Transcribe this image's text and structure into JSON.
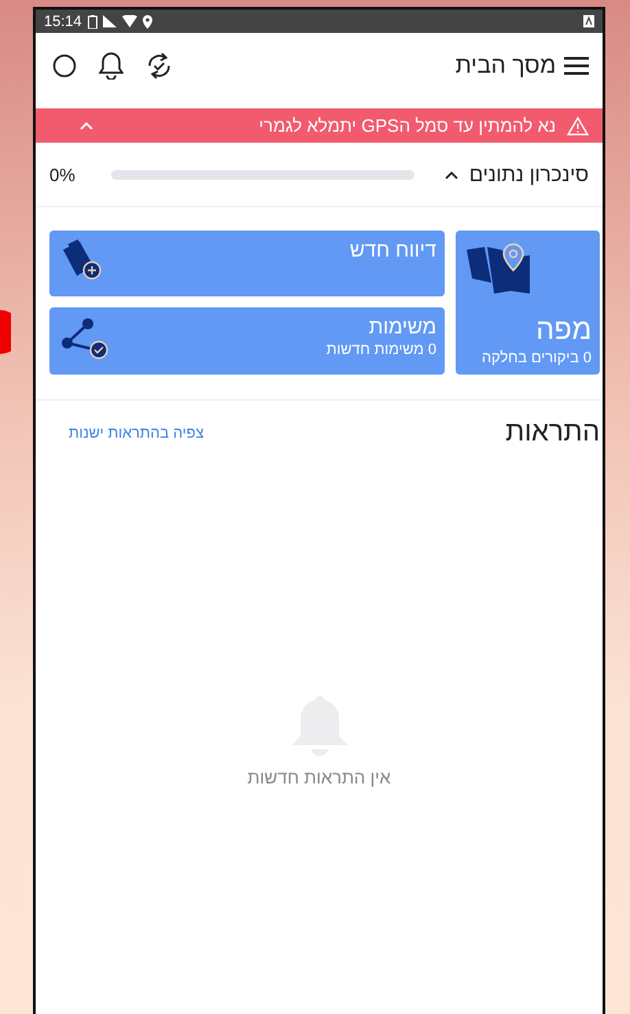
{
  "status_bar": {
    "time": "15:14"
  },
  "header": {
    "title": "מסך הבית"
  },
  "alert": {
    "text": "נא להמתין עד סמל הGPS יתמלא לגמרי",
    "expanded": true
  },
  "sync": {
    "label": "סינכרון נתונים",
    "level": 0,
    "reading": "0%",
    "expanded": true
  },
  "cards": [
    {
      "kind": "map",
      "title": "מפה",
      "subtitle": "0 ביקורים בחלקה"
    },
    {
      "kind": "report",
      "title": "דיווח חדש"
    },
    {
      "kind": "tasks",
      "title": "משימות",
      "subtitle": "0 משימות חדשות"
    }
  ],
  "notifications": {
    "title": "התראות",
    "link": "צפיה בהתראות ישנות",
    "empty_text": "אין התראות חדשות"
  }
}
